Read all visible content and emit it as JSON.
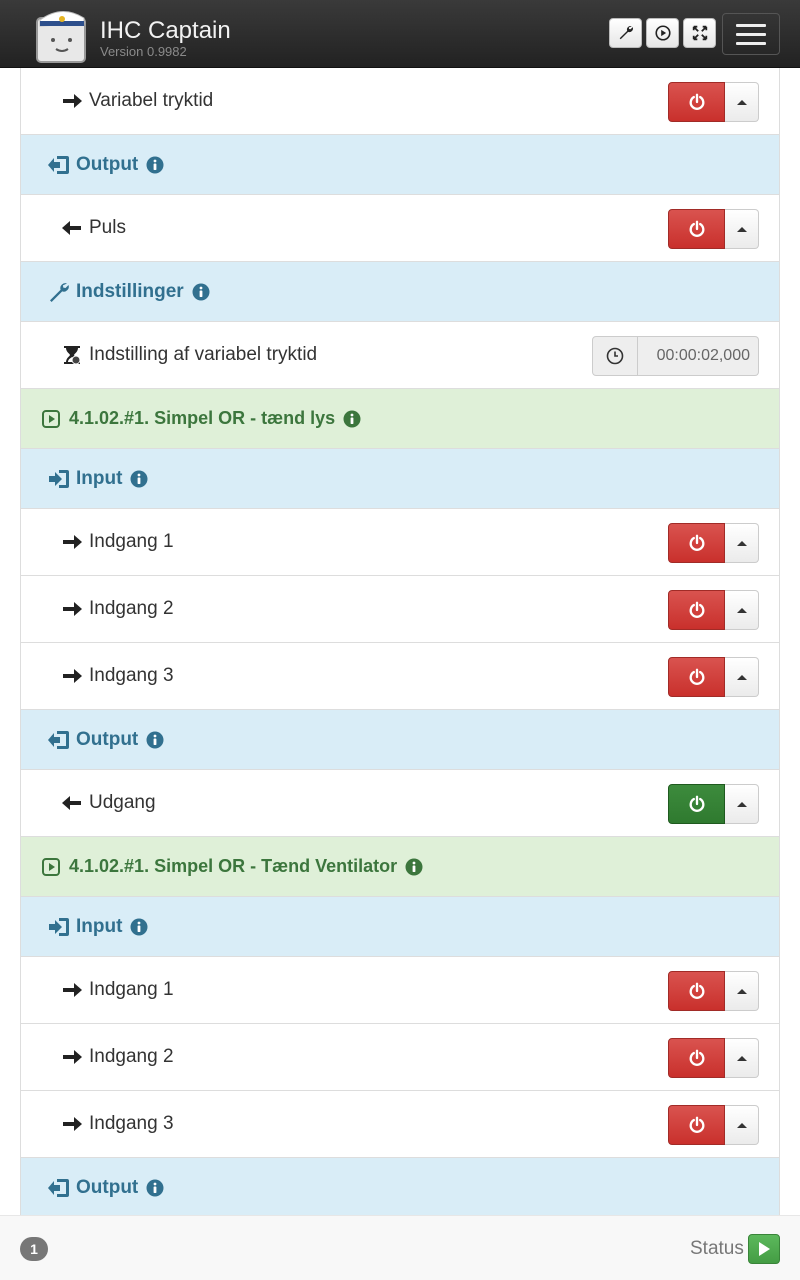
{
  "app": {
    "title": "IHC Captain",
    "version": "Version 0.9982"
  },
  "toolbar": {
    "buttons": [
      "wrench-icon",
      "play-circle-icon",
      "fullscreen-icon"
    ],
    "menu": "hamburger-menu-icon"
  },
  "colors": {
    "navbar": "#2b2b2b",
    "section_header_bg": "#d9edf7",
    "section_header_text": "#31708f",
    "group_header_bg": "#dff0d8",
    "group_header_text": "#3c763d",
    "off_button": "#d9534f",
    "on_button": "#449d44"
  },
  "rows": [
    {
      "kind": "item",
      "icon": "arrow-right-icon",
      "label": "Variabel tryktid",
      "state": "off"
    },
    {
      "kind": "section",
      "icon": "output-icon",
      "label": "Output"
    },
    {
      "kind": "item",
      "icon": "arrow-left-icon",
      "label": "Puls",
      "state": "off"
    },
    {
      "kind": "section",
      "icon": "wrench-icon",
      "label": "Indstillinger"
    },
    {
      "kind": "setting",
      "icon": "hourglass-icon",
      "label": "Indstilling af variabel tryktid",
      "value": "00:00:02,000"
    },
    {
      "kind": "group",
      "icon": "play-square-icon",
      "label": "4.1.02.#1. Simpel OR - tænd lys"
    },
    {
      "kind": "section",
      "icon": "input-icon",
      "label": "Input"
    },
    {
      "kind": "item",
      "icon": "arrow-right-icon",
      "label": "Indgang 1",
      "state": "off"
    },
    {
      "kind": "item",
      "icon": "arrow-right-icon",
      "label": "Indgang 2",
      "state": "off"
    },
    {
      "kind": "item",
      "icon": "arrow-right-icon",
      "label": "Indgang 3",
      "state": "off"
    },
    {
      "kind": "section",
      "icon": "output-icon",
      "label": "Output"
    },
    {
      "kind": "item",
      "icon": "arrow-left-icon",
      "label": "Udgang",
      "state": "on"
    },
    {
      "kind": "group",
      "icon": "play-square-icon",
      "label": "4.1.02.#1. Simpel OR - Tænd Ventilator"
    },
    {
      "kind": "section",
      "icon": "input-icon",
      "label": "Input"
    },
    {
      "kind": "item",
      "icon": "arrow-right-icon",
      "label": "Indgang 1",
      "state": "off"
    },
    {
      "kind": "item",
      "icon": "arrow-right-icon",
      "label": "Indgang 2",
      "state": "off"
    },
    {
      "kind": "item",
      "icon": "arrow-right-icon",
      "label": "Indgang 3",
      "state": "off"
    },
    {
      "kind": "section",
      "icon": "output-icon",
      "label": "Output"
    }
  ],
  "footer": {
    "badge": "1",
    "status_label": "Status"
  }
}
